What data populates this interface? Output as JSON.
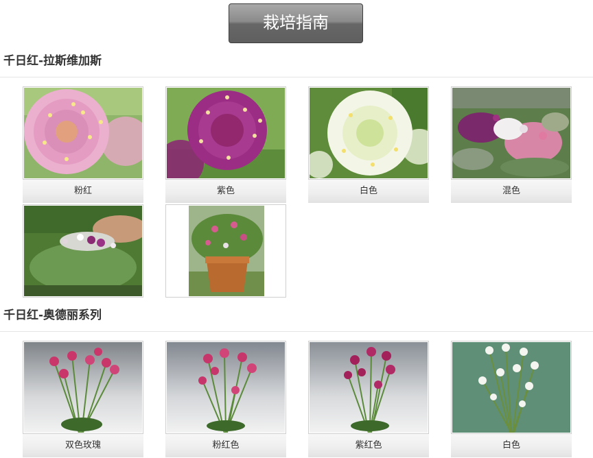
{
  "header": {
    "guide_button_label": "栽培指南"
  },
  "sections": [
    {
      "title": "千日红-拉斯维加斯",
      "items": [
        {
          "caption": "粉红",
          "image": "pink-globe-amaranth-photo"
        },
        {
          "caption": "紫色",
          "image": "purple-globe-amaranth-photo"
        },
        {
          "caption": "白色",
          "image": "white-globe-amaranth-photo"
        },
        {
          "caption": "混色",
          "image": "mixed-color-flowerbed-photo"
        },
        {
          "caption": "",
          "image": "garden-planting-photo"
        },
        {
          "caption": "",
          "image": "potted-planting-photo"
        }
      ]
    },
    {
      "title": "千日红-奥德丽系列",
      "items": [
        {
          "caption": "双色玫瑰",
          "image": "bicolor-rose-plant-photo"
        },
        {
          "caption": "粉红色",
          "image": "pink-plant-photo"
        },
        {
          "caption": "紫红色",
          "image": "purple-red-plant-photo"
        },
        {
          "caption": "白色",
          "image": "white-plant-photo"
        }
      ]
    }
  ]
}
